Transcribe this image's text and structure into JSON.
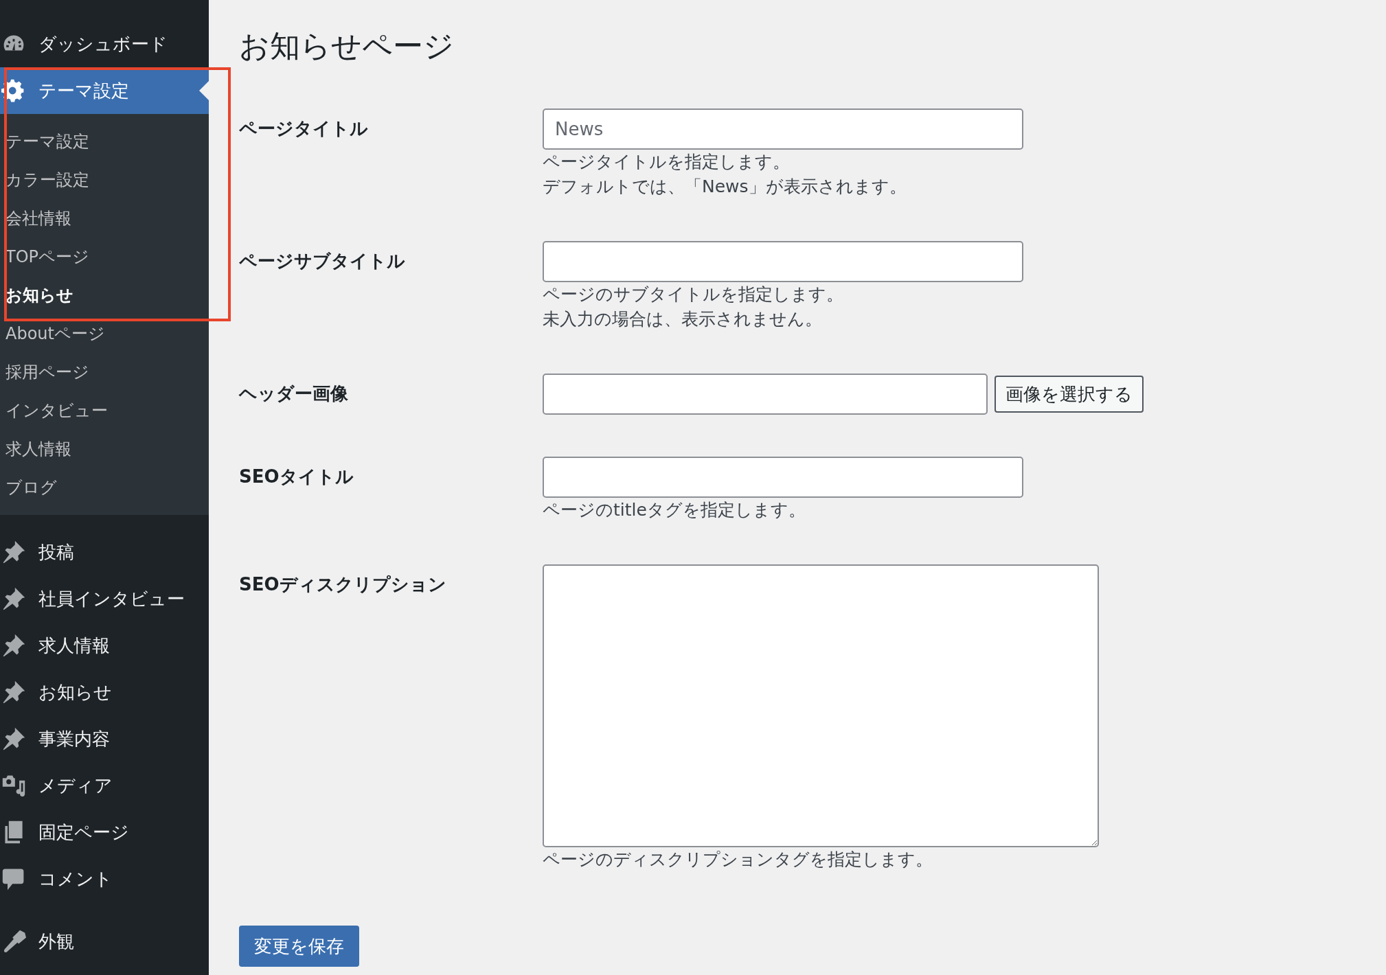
{
  "sidebar": {
    "menu_groups": [
      {
        "items": [
          {
            "label": "ダッシュボード",
            "kind": "dashboard",
            "selected": false
          },
          {
            "label": "テーマ設定",
            "kind": "settings",
            "selected": true,
            "children": [
              {
                "label": "テーマ設定",
                "selected": false
              },
              {
                "label": "カラー設定",
                "selected": false
              },
              {
                "label": "会社情報",
                "selected": false
              },
              {
                "label": "TOPページ",
                "selected": false
              },
              {
                "label": "お知らせ",
                "selected": true
              },
              {
                "label": "Aboutページ",
                "selected": false
              },
              {
                "label": "採用ページ",
                "selected": false
              },
              {
                "label": "インタビュー",
                "selected": false
              },
              {
                "label": "求人情報",
                "selected": false
              },
              {
                "label": "ブログ",
                "selected": false
              }
            ]
          },
          {
            "label": "投稿",
            "kind": "pin",
            "selected": false
          },
          {
            "label": "社員インタビュー",
            "kind": "pin",
            "selected": false
          },
          {
            "label": "求人情報",
            "kind": "pin",
            "selected": false
          },
          {
            "label": "お知らせ",
            "kind": "pin",
            "selected": false
          },
          {
            "label": "事業内容",
            "kind": "pin",
            "selected": false
          },
          {
            "label": "メディア",
            "kind": "media",
            "selected": false
          },
          {
            "label": "固定ページ",
            "kind": "pages",
            "selected": false
          },
          {
            "label": "コメント",
            "kind": "comment",
            "selected": false
          }
        ]
      },
      {
        "items": [
          {
            "label": "外観",
            "kind": "brush",
            "selected": false
          }
        ]
      }
    ]
  },
  "page": {
    "title": "お知らせページ",
    "fields": [
      {
        "label": "ページタイトル",
        "kind": "text",
        "placeholder": "News",
        "help": [
          "ページタイトルを指定します。",
          "デフォルトでは、「News」が表示されます。"
        ]
      },
      {
        "label": "ページサブタイトル",
        "kind": "text",
        "help": [
          "ページのサブタイトルを指定します。",
          "未入力の場合は、表示されません。"
        ]
      },
      {
        "label": "ヘッダー画像",
        "kind": "image",
        "button": "画像を選択する"
      },
      {
        "label": "SEOタイトル",
        "kind": "text",
        "help": [
          "ページのtitleタグを指定します。"
        ]
      },
      {
        "label": "SEOディスクリプション",
        "kind": "textarea",
        "help": [
          "ページのディスクリプションタグを指定します。"
        ]
      }
    ],
    "save_button": "変更を保存"
  }
}
